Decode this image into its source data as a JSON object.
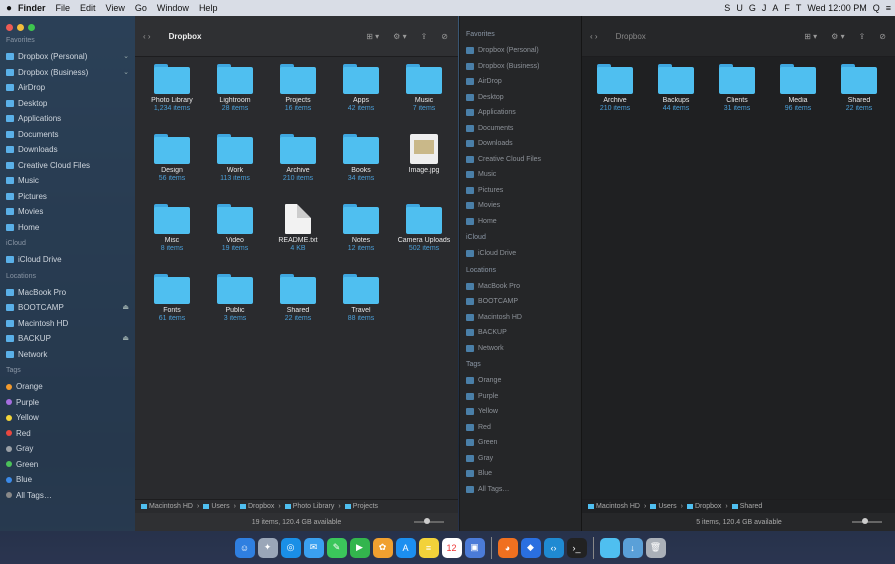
{
  "menubar": {
    "apple": "",
    "items": [
      "Finder",
      "File",
      "Edit",
      "View",
      "Go",
      "Window",
      "Help"
    ],
    "right": [
      "S",
      "U",
      "G",
      "J",
      "A",
      "F",
      "T",
      "Wed 12:00 PM",
      "Q",
      "≡"
    ]
  },
  "window1": {
    "title": "Dropbox",
    "nav": "‹  ›",
    "tools": [
      "⊞ ▾",
      "⚙ ▾",
      "⇪",
      "⊘"
    ],
    "sidebar": {
      "sections": [
        {
          "label": "Favorites",
          "items": [
            {
              "label": "Dropbox (Personal)",
              "eject": "⌄"
            },
            {
              "label": "Dropbox (Business)",
              "eject": "⌄"
            },
            {
              "label": "AirDrop"
            },
            {
              "label": "Desktop"
            },
            {
              "label": "Applications"
            },
            {
              "label": "Documents"
            },
            {
              "label": "Downloads"
            },
            {
              "label": "Creative Cloud Files"
            },
            {
              "label": "Music"
            },
            {
              "label": "Pictures"
            },
            {
              "label": "Movies"
            },
            {
              "label": "Home"
            }
          ]
        },
        {
          "label": "iCloud",
          "items": [
            {
              "label": "iCloud Drive"
            }
          ]
        },
        {
          "label": "Locations",
          "items": [
            {
              "label": "MacBook Pro",
              "eject": ""
            },
            {
              "label": "BOOTCAMP",
              "eject": "⏏"
            },
            {
              "label": "Macintosh HD",
              "eject": ""
            },
            {
              "label": "BACKUP",
              "eject": "⏏"
            },
            {
              "label": "Network",
              "eject": ""
            }
          ]
        },
        {
          "label": "Tags",
          "items": [
            {
              "label": "Orange",
              "color": "#f29a2e"
            },
            {
              "label": "Purple",
              "color": "#a66ee0"
            },
            {
              "label": "Yellow",
              "color": "#f2d43a"
            },
            {
              "label": "Red",
              "color": "#e9473f"
            },
            {
              "label": "Gray",
              "color": "#9aa0a6"
            },
            {
              "label": "Green",
              "color": "#4bc15a"
            },
            {
              "label": "Blue",
              "color": "#3b8ae8"
            },
            {
              "label": "All Tags…",
              "color": "#888888"
            }
          ]
        }
      ]
    },
    "items": [
      {
        "name": "Photo Library",
        "meta": "1,234 items",
        "kind": "folder"
      },
      {
        "name": "Lightroom",
        "meta": "28 items",
        "kind": "folder"
      },
      {
        "name": "Projects",
        "meta": "16 items",
        "kind": "folder"
      },
      {
        "name": "Apps",
        "meta": "42 items",
        "kind": "folder"
      },
      {
        "name": "Music",
        "meta": "7 items",
        "kind": "folder"
      },
      {
        "name": "Design",
        "meta": "56 items",
        "kind": "folder"
      },
      {
        "name": "Work",
        "meta": "113 items",
        "kind": "folder"
      },
      {
        "name": "Archive",
        "meta": "210 items",
        "kind": "folder"
      },
      {
        "name": "Books",
        "meta": "34 items",
        "kind": "folder"
      },
      {
        "name": "Image.jpg",
        "meta": "",
        "kind": "image"
      },
      {
        "name": "Misc",
        "meta": "8 items",
        "kind": "folder"
      },
      {
        "name": "Video",
        "meta": "19 items",
        "kind": "folder"
      },
      {
        "name": "README.txt",
        "meta": "4 KB",
        "kind": "doc"
      },
      {
        "name": "Notes",
        "meta": "12 items",
        "kind": "folder"
      },
      {
        "name": "Camera Uploads",
        "meta": "502 items",
        "kind": "folder"
      },
      {
        "name": "Fonts",
        "meta": "61 items",
        "kind": "folder"
      },
      {
        "name": "Public",
        "meta": "3 items",
        "kind": "folder"
      },
      {
        "name": "Shared",
        "meta": "22 items",
        "kind": "folder"
      },
      {
        "name": "Travel",
        "meta": "88 items",
        "kind": "folder"
      }
    ],
    "pathbar": [
      "Macintosh HD",
      "Users",
      "Dropbox",
      "Photo Library",
      "Projects"
    ],
    "status": "19 items, 120.4 GB available"
  },
  "window2": {
    "title": "Dropbox",
    "nav": "‹  ›",
    "tools": [
      "⊞ ▾",
      "⚙ ▾",
      "⇪",
      "⊘"
    ],
    "sidebar": [
      {
        "label": "Favorites",
        "section": true
      },
      {
        "label": "Dropbox (Personal)"
      },
      {
        "label": "Dropbox (Business)"
      },
      {
        "label": "AirDrop"
      },
      {
        "label": "Desktop"
      },
      {
        "label": "Applications"
      },
      {
        "label": "Documents"
      },
      {
        "label": "Downloads"
      },
      {
        "label": "Creative Cloud Files"
      },
      {
        "label": "Music"
      },
      {
        "label": "Pictures"
      },
      {
        "label": "Movies"
      },
      {
        "label": "Home"
      },
      {
        "label": "iCloud",
        "section": true
      },
      {
        "label": "iCloud Drive"
      },
      {
        "label": "Locations",
        "section": true
      },
      {
        "label": "MacBook Pro"
      },
      {
        "label": "BOOTCAMP"
      },
      {
        "label": "Macintosh HD"
      },
      {
        "label": "BACKUP"
      },
      {
        "label": "Network"
      },
      {
        "label": "Tags",
        "section": true
      },
      {
        "label": "Orange"
      },
      {
        "label": "Purple"
      },
      {
        "label": "Yellow"
      },
      {
        "label": "Red"
      },
      {
        "label": "Green"
      },
      {
        "label": "Gray"
      },
      {
        "label": "Blue"
      },
      {
        "label": "All Tags…"
      }
    ],
    "items": [
      {
        "name": "Archive",
        "meta": "210 items"
      },
      {
        "name": "Backups",
        "meta": "44 items"
      },
      {
        "name": "Clients",
        "meta": "31 items"
      },
      {
        "name": "Media",
        "meta": "96 items"
      },
      {
        "name": "Shared",
        "meta": "22 items"
      }
    ],
    "pathbar": [
      "Macintosh HD",
      "Users",
      "Dropbox",
      "Shared"
    ],
    "status": "5 items, 120.4 GB available"
  },
  "dock": [
    {
      "label": "Finder",
      "color": "#2f7fe0",
      "glyph": "☺"
    },
    {
      "label": "Launchpad",
      "color": "#9aa6b8",
      "glyph": "✦"
    },
    {
      "label": "Safari",
      "color": "#1a8fe6",
      "glyph": "◎"
    },
    {
      "label": "Mail",
      "color": "#3aa0f0",
      "glyph": "✉"
    },
    {
      "label": "Messages",
      "color": "#3bc65b",
      "glyph": "✎"
    },
    {
      "label": "FaceTime",
      "color": "#33b54d",
      "glyph": "▶"
    },
    {
      "label": "Photos",
      "color": "#f0a030",
      "glyph": "✿"
    },
    {
      "label": "App Store",
      "color": "#1c8ff0",
      "glyph": "A"
    },
    {
      "label": "Notes",
      "color": "#f2d23a",
      "glyph": "≡"
    },
    {
      "label": "Calendar",
      "color": "#ffffff",
      "glyph": "12"
    },
    {
      "label": "Preview",
      "color": "#4b7bd8",
      "glyph": "▣"
    },
    {
      "label": "Firefox",
      "color": "#f07020",
      "glyph": "◕"
    },
    {
      "label": "Dropbox",
      "color": "#2a6fe0",
      "glyph": "◆"
    },
    {
      "label": "VS Code",
      "color": "#1f8ad2",
      "glyph": "‹›"
    },
    {
      "label": "Terminal",
      "color": "#222222",
      "glyph": "›_"
    },
    {
      "label": "Folder",
      "color": "#4fbff0",
      "glyph": ""
    },
    {
      "label": "Downloads",
      "color": "#5aa0d8",
      "glyph": "↓"
    },
    {
      "label": "Trash",
      "color": "#aab0b8",
      "glyph": "🗑"
    }
  ]
}
